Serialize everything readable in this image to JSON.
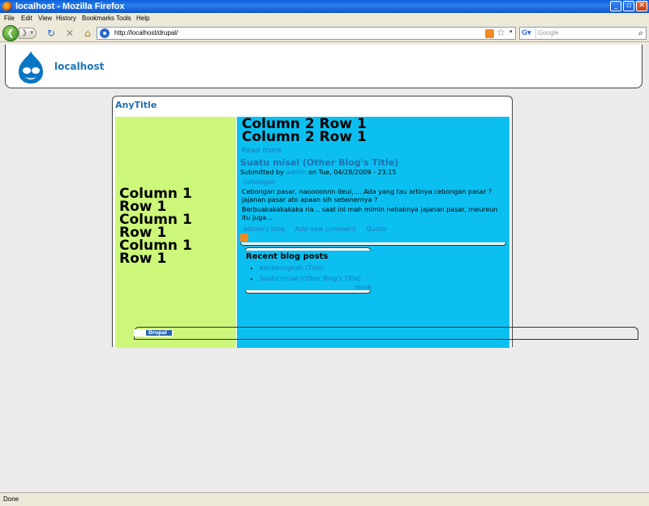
{
  "window": {
    "title": "localhost - Mozilla Firefox"
  },
  "menu": [
    "File",
    "Edit",
    "View",
    "History",
    "Bookmarks",
    "Tools",
    "Help"
  ],
  "navbar": {
    "url": "http://localhost/drupal/",
    "search_placeholder": "Google"
  },
  "site": {
    "name": "localhost"
  },
  "page": {
    "title": "AnyTitle",
    "col1_text": "Column 1 Row 1 Column 1 Row 1 Column 1 Row 1",
    "col2_text": "Column 2 Row 1 Column 2 Row 1",
    "read_more": "Read more",
    "node": {
      "title": "Suatu misal (Other Blog's Title)",
      "submitted_prefix": "Submitted by ",
      "author": "admin",
      "submitted_suffix": " on Tue, 04/28/2009 - 23:15",
      "tag": "cebongan",
      "body1": "Cebongan pasar, naoooonnn deui,.....Ada yang tau artinya cebongan pasar ? jajanan pasar ato apaan sih sebenernya ?",
      "body2": "Berbuakakakakaka ria... saat ini mah mimin nebaknya jajanan pasar, meureun itu juga...",
      "links": [
        "admin's blog",
        "Add new comment",
        "Quote"
      ]
    },
    "block": {
      "title": "Recent blog posts",
      "items": [
        "Kecebongkah (Title)",
        "Suatu misal (Other Blog's Title)"
      ],
      "more": "more"
    },
    "footer": {
      "powered": "Drupal"
    }
  },
  "status": {
    "text": "Done"
  }
}
